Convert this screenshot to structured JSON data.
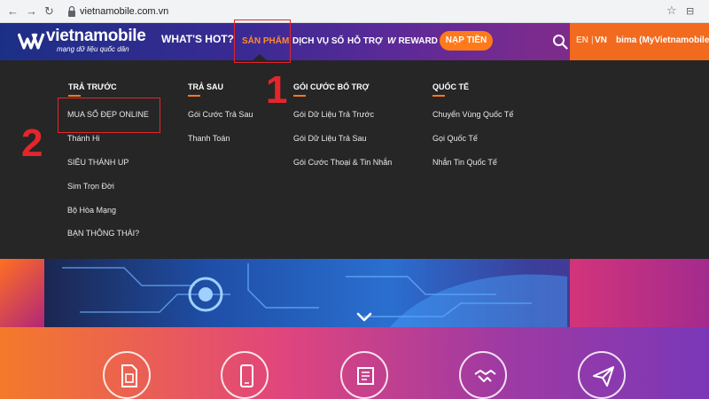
{
  "browser": {
    "back": "←",
    "forward": "→",
    "reload": "↻",
    "url": "vietnamobile.com.vn",
    "star_icon": "star-icon",
    "ext_icon": "extensions-icon"
  },
  "header": {
    "logo_text": "vietnamobile",
    "logo_tagline": "mạng dữ liệu quốc dân",
    "nav": {
      "whats_hot": "WHAT'S HOT?",
      "san_pham": "SẢN PHẨM",
      "dich_vu_so": "DỊCH VỤ SỐ",
      "ho_tro": "HỖ TRỢ",
      "reward_mark": "W",
      "reward": "REWARD"
    },
    "nap_tien": "NẠP TIỀN",
    "lang_en": "EN",
    "lang_sep": "|",
    "lang_vn": "VN",
    "user": "bima (MyVietnamobile"
  },
  "menu": {
    "columns": [
      {
        "heading": "TRẢ TRƯỚC",
        "items": [
          "MUA SỐ ĐẸP ONLINE",
          "Thánh Hi",
          "SIÊU THÁNH UP",
          "Sim Trọn Đời",
          "Bộ Hòa Mạng",
          "BẠN THÔNG THÁI?"
        ]
      },
      {
        "heading": "TRẢ SAU",
        "items": [
          "Gói Cước Trả Sau",
          "Thanh Toán"
        ]
      },
      {
        "heading": "GÓI CƯỚC BỔ TRỢ",
        "items": [
          "Gói Dữ Liệu Trả Trước",
          "Gói Dữ Liệu Trả Sau",
          "Gói Cước Thoại & Tin Nhắn"
        ]
      },
      {
        "heading": "QUỐC TẾ",
        "items": [
          "Chuyển Vùng Quốc Tế",
          "Gọi Quốc Tế",
          "Nhắn Tin Quốc Tế"
        ]
      }
    ]
  },
  "annotations": {
    "step1": "1",
    "step2": "2",
    "color": "#e4262c"
  },
  "colors": {
    "accent_orange": "#ff7a1a",
    "menu_bg": "#262626"
  }
}
